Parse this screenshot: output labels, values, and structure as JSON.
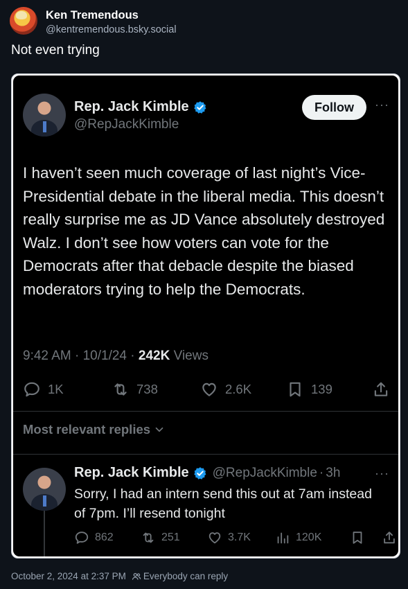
{
  "post": {
    "author_name": "Ken Tremendous",
    "author_handle": "@kentremendous.bsky.social",
    "text": "Not even trying",
    "timestamp": "October 2, 2024 at 2:37 PM",
    "reply_setting": "Everybody can reply"
  },
  "tweet": {
    "name": "Rep. Jack Kimble",
    "handle": "@RepJackKimble",
    "follow_label": "Follow",
    "more": "···",
    "body": "I haven’t seen much coverage of last night’s Vice-Presidential debate in the liberal media. This doesn’t really surprise me as JD Vance absolutely destroyed Walz. I don’t see how voters can vote for the Democrats after that debacle despite the biased moderators trying to help the Democrats.",
    "time": "9:42 AM",
    "date": "10/1/24",
    "views_count": "242K",
    "views_label": "Views",
    "replies": "1K",
    "reposts": "738",
    "likes": "2.6K",
    "bookmarks": "139",
    "relevant_label": "Most relevant replies"
  },
  "reply": {
    "name": "Rep. Jack Kimble",
    "handle": "@RepJackKimble",
    "age": "3h",
    "text": "Sorry, I had an intern send this out at 7am instead of 7pm. I’ll resend tonight",
    "replies": "862",
    "reposts": "251",
    "likes": "3.7K",
    "views": "120K"
  },
  "colors": {
    "verified": "#1d9bf0",
    "muted": "#71767b",
    "page_bg": "#0e131a"
  }
}
